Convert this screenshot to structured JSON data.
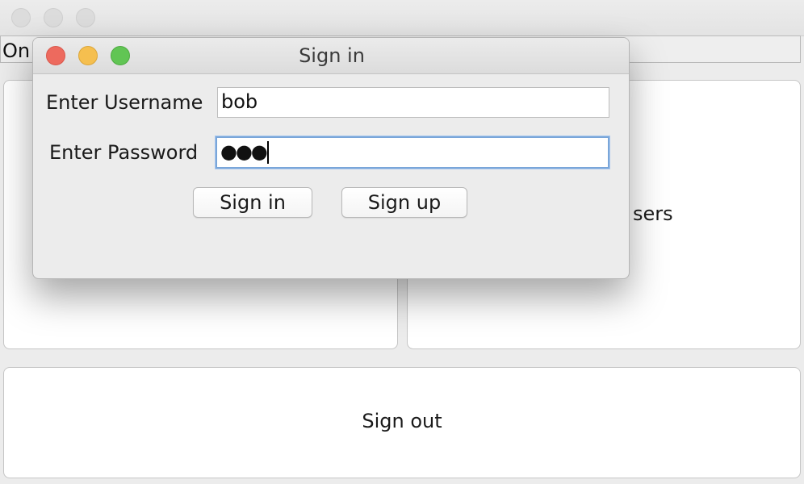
{
  "main_window": {
    "status_text": "On",
    "right_panel_label": "sers",
    "sign_out_label": "Sign out"
  },
  "dialog": {
    "title": "Sign in",
    "username_label": "Enter Username",
    "username_value": "bob",
    "password_label": "Enter Password",
    "password_masked": "●●●",
    "sign_in_label": "Sign in",
    "sign_up_label": "Sign up"
  },
  "colors": {
    "close": "#ed6a5e",
    "minimize": "#f5bf4f",
    "zoom": "#61c554",
    "focus_ring": "#7aa6d9"
  }
}
